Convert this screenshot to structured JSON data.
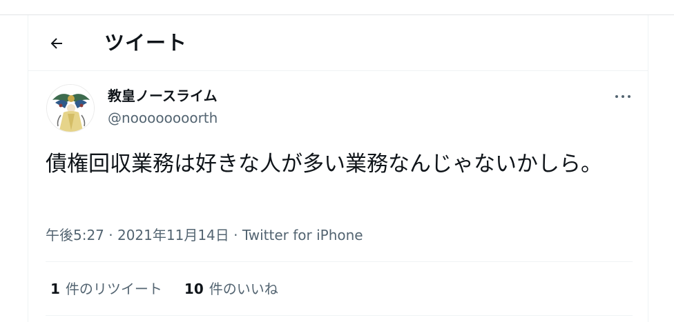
{
  "header": {
    "title": "ツイート",
    "back_icon": "arrow-left-icon"
  },
  "tweet": {
    "author": {
      "display_name": "教皇ノースライム",
      "handle": "@noooooooorth",
      "avatar": "avatar-illustration"
    },
    "more_icon": "more-horizontal-icon",
    "text": "債権回収業務は好きな人が多い業務なんじゃないかしら。",
    "meta": "午後5:27 · 2021年11月14日 · Twitter for iPhone",
    "stats": {
      "retweets_count": "1",
      "retweets_label": "件のリツイート",
      "likes_count": "10",
      "likes_label": "件のいいね"
    }
  },
  "colors": {
    "text_primary": "#0f1419",
    "text_secondary": "#536471",
    "border": "#eff3f4"
  }
}
